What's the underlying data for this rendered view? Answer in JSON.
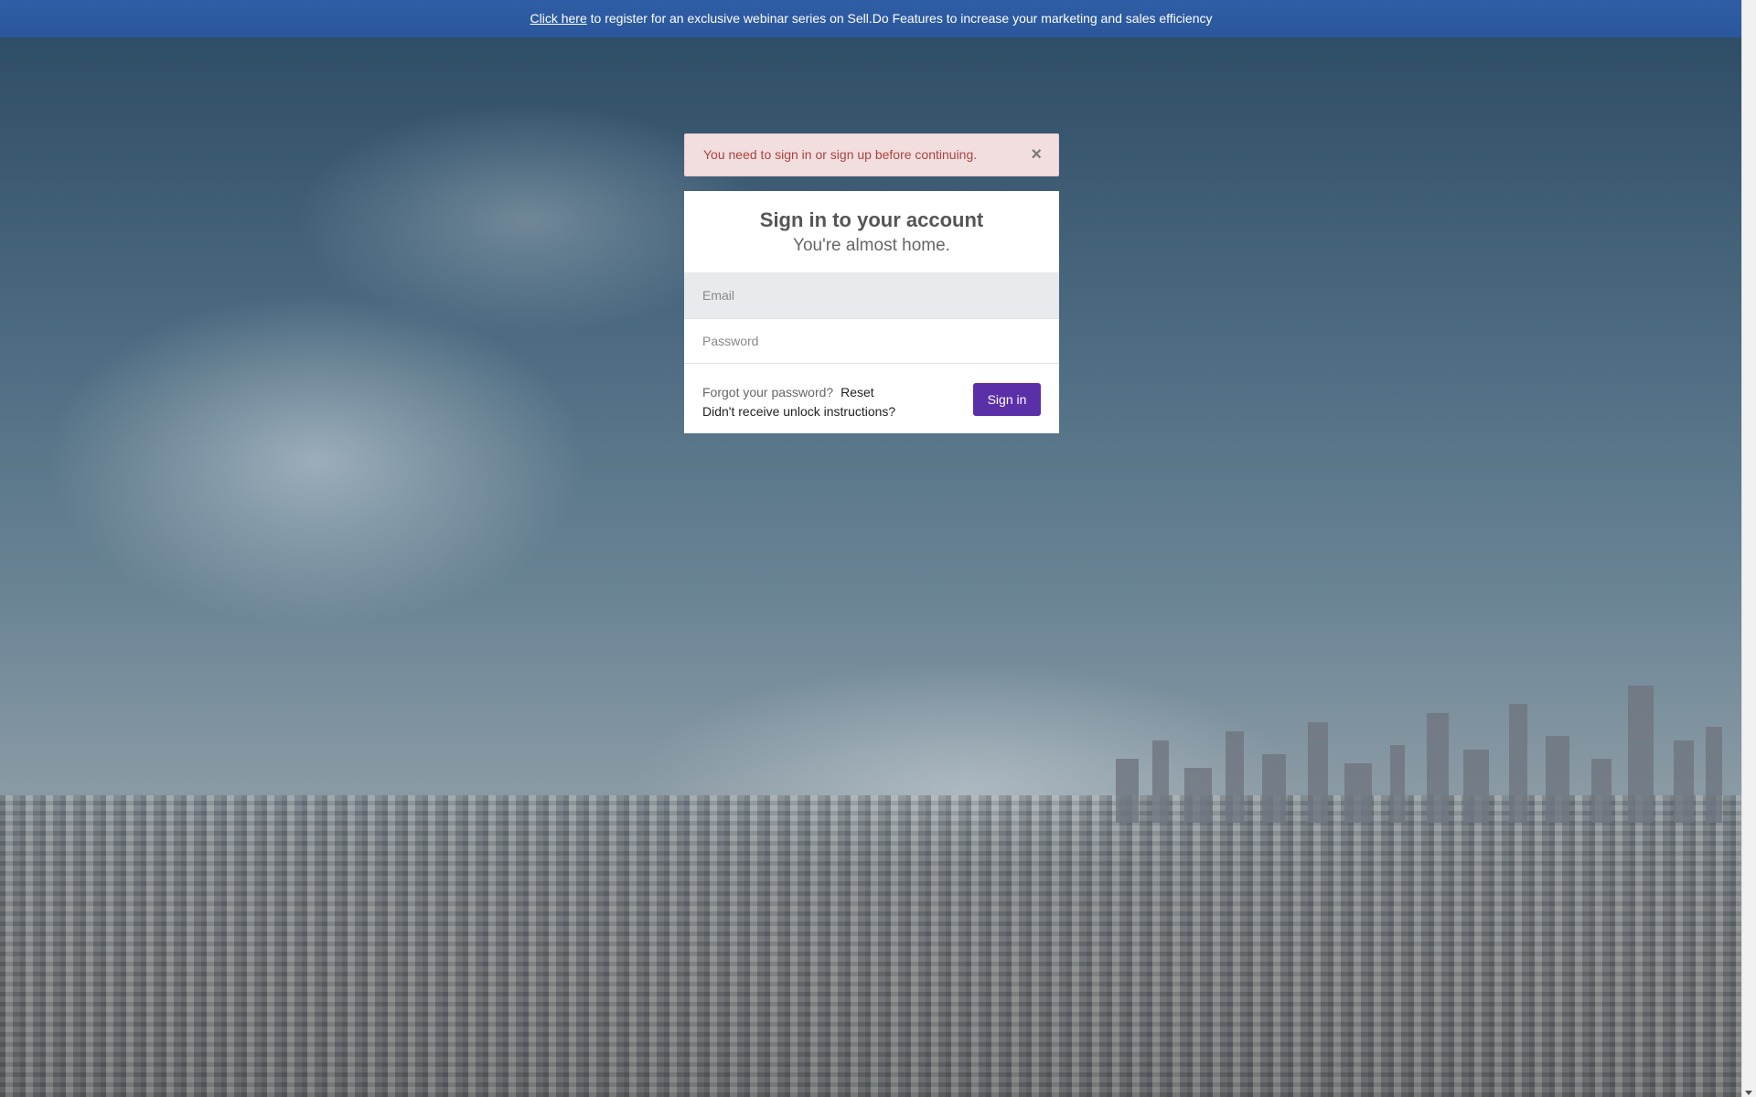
{
  "banner": {
    "link_text": "Click here",
    "text": " to register for an exclusive webinar series on Sell.Do Features to increase your marketing and sales efficiency"
  },
  "alert": {
    "message": "You need to sign in or sign up before continuing.",
    "close_symbol": "×"
  },
  "login": {
    "title": "Sign in to your account",
    "subtitle": "You're almost home.",
    "email_placeholder": "Email",
    "email_value": "",
    "password_placeholder": "Password",
    "password_value": "",
    "forgot_text": "Forgot your password?",
    "reset_link": "Reset",
    "unlock_link": "Didn't receive unlock instructions?",
    "signin_label": "Sign in"
  },
  "colors": {
    "banner": "#2c5aa0",
    "alert_bg": "#f2dede",
    "alert_text": "#a94442",
    "signin_button": "#5b2fa8"
  }
}
